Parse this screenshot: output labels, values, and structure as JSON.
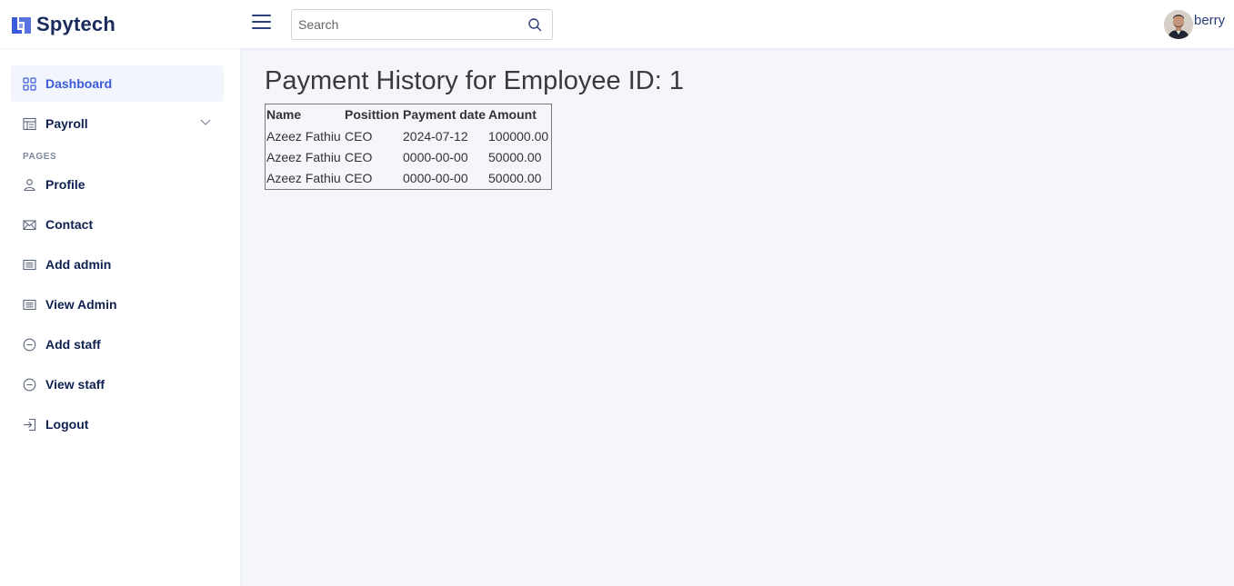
{
  "brand": {
    "name": "Spytech",
    "accent": "#3b5bdb"
  },
  "header": {
    "search_placeholder": "Search",
    "user_name": "berry"
  },
  "sidebar": {
    "items": [
      {
        "label": "Dashboard",
        "icon": "grid-icon",
        "active": true
      },
      {
        "label": "Payroll",
        "icon": "table-icon",
        "has_submenu": true
      }
    ],
    "section_label": "PAGES",
    "pages": [
      {
        "label": "Profile",
        "icon": "user-icon"
      },
      {
        "label": "Contact",
        "icon": "mail-icon"
      },
      {
        "label": "Add admin",
        "icon": "list-icon"
      },
      {
        "label": "View Admin",
        "icon": "list-icon"
      },
      {
        "label": "Add staff",
        "icon": "minus-circle-icon"
      },
      {
        "label": "View staff",
        "icon": "minus-circle-icon"
      },
      {
        "label": "Logout",
        "icon": "logout-icon"
      }
    ]
  },
  "main": {
    "title": "Payment History for Employee ID: 1",
    "table": {
      "headers": [
        "Name",
        "Posittion",
        "Payment date",
        "Amount"
      ],
      "rows": [
        [
          "Azeez Fathiu",
          "CEO",
          "2024-07-12",
          "100000.00"
        ],
        [
          "Azeez Fathiu",
          "CEO",
          "0000-00-00",
          "50000.00"
        ],
        [
          "Azeez Fathiu",
          "CEO",
          "0000-00-00",
          "50000.00"
        ]
      ]
    }
  }
}
